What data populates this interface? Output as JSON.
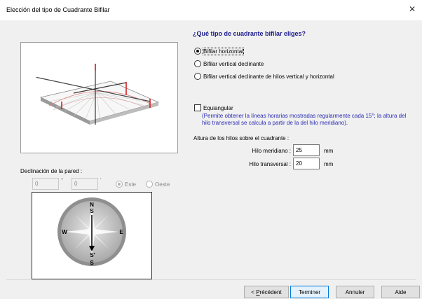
{
  "window": {
    "title": "Elección del tipo de Cuadrante Bifilar",
    "close_glyph": "✕"
  },
  "question": "¿Qué tipo de cuadrante bifilar eliges?",
  "dial_types": [
    {
      "label": "Bifilar horizontal",
      "checked": true
    },
    {
      "label": "Bifilar vertical declinante",
      "checked": false
    },
    {
      "label": "Bifilar vertical declinante de hilos vertical y horizontal",
      "checked": false
    }
  ],
  "equiangular": {
    "label": "Equiangular",
    "checked": false,
    "note": "(Permite obtener la líneas horarias mostradas regularmente cada 15°; la altura del hilo transversal se calcula a partir de la del hilo meridiano)."
  },
  "heights": {
    "title": "Altura de los hilos sobre el cuadrante :",
    "meridian": {
      "label": "Hilo meridiano :",
      "value": "25",
      "unit": "mm"
    },
    "transversal": {
      "label": "Hilo transversal :",
      "value": "20",
      "unit": "mm"
    }
  },
  "declination": {
    "title": "Declinación de la pared :",
    "degrees": "0",
    "minutes": "0",
    "deg_symbol": "°",
    "min_symbol": "'",
    "east_label": "Este",
    "west_label": "Oeste",
    "east_checked": true
  },
  "compass": {
    "north": "N",
    "south": "S",
    "south_prime": "S'",
    "south_lower": "S",
    "west": "W",
    "east": "E"
  },
  "buttons": {
    "previous_underline": "P",
    "previous_rest": "récédent",
    "previous_prefix": "< ",
    "finish": "Terminer",
    "cancel": "Annuler",
    "help": "Aide"
  },
  "colors": {
    "accent": "#0078d7",
    "heading": "#1a1a8c",
    "note": "#2b2bb5",
    "wire": "#d42020"
  }
}
